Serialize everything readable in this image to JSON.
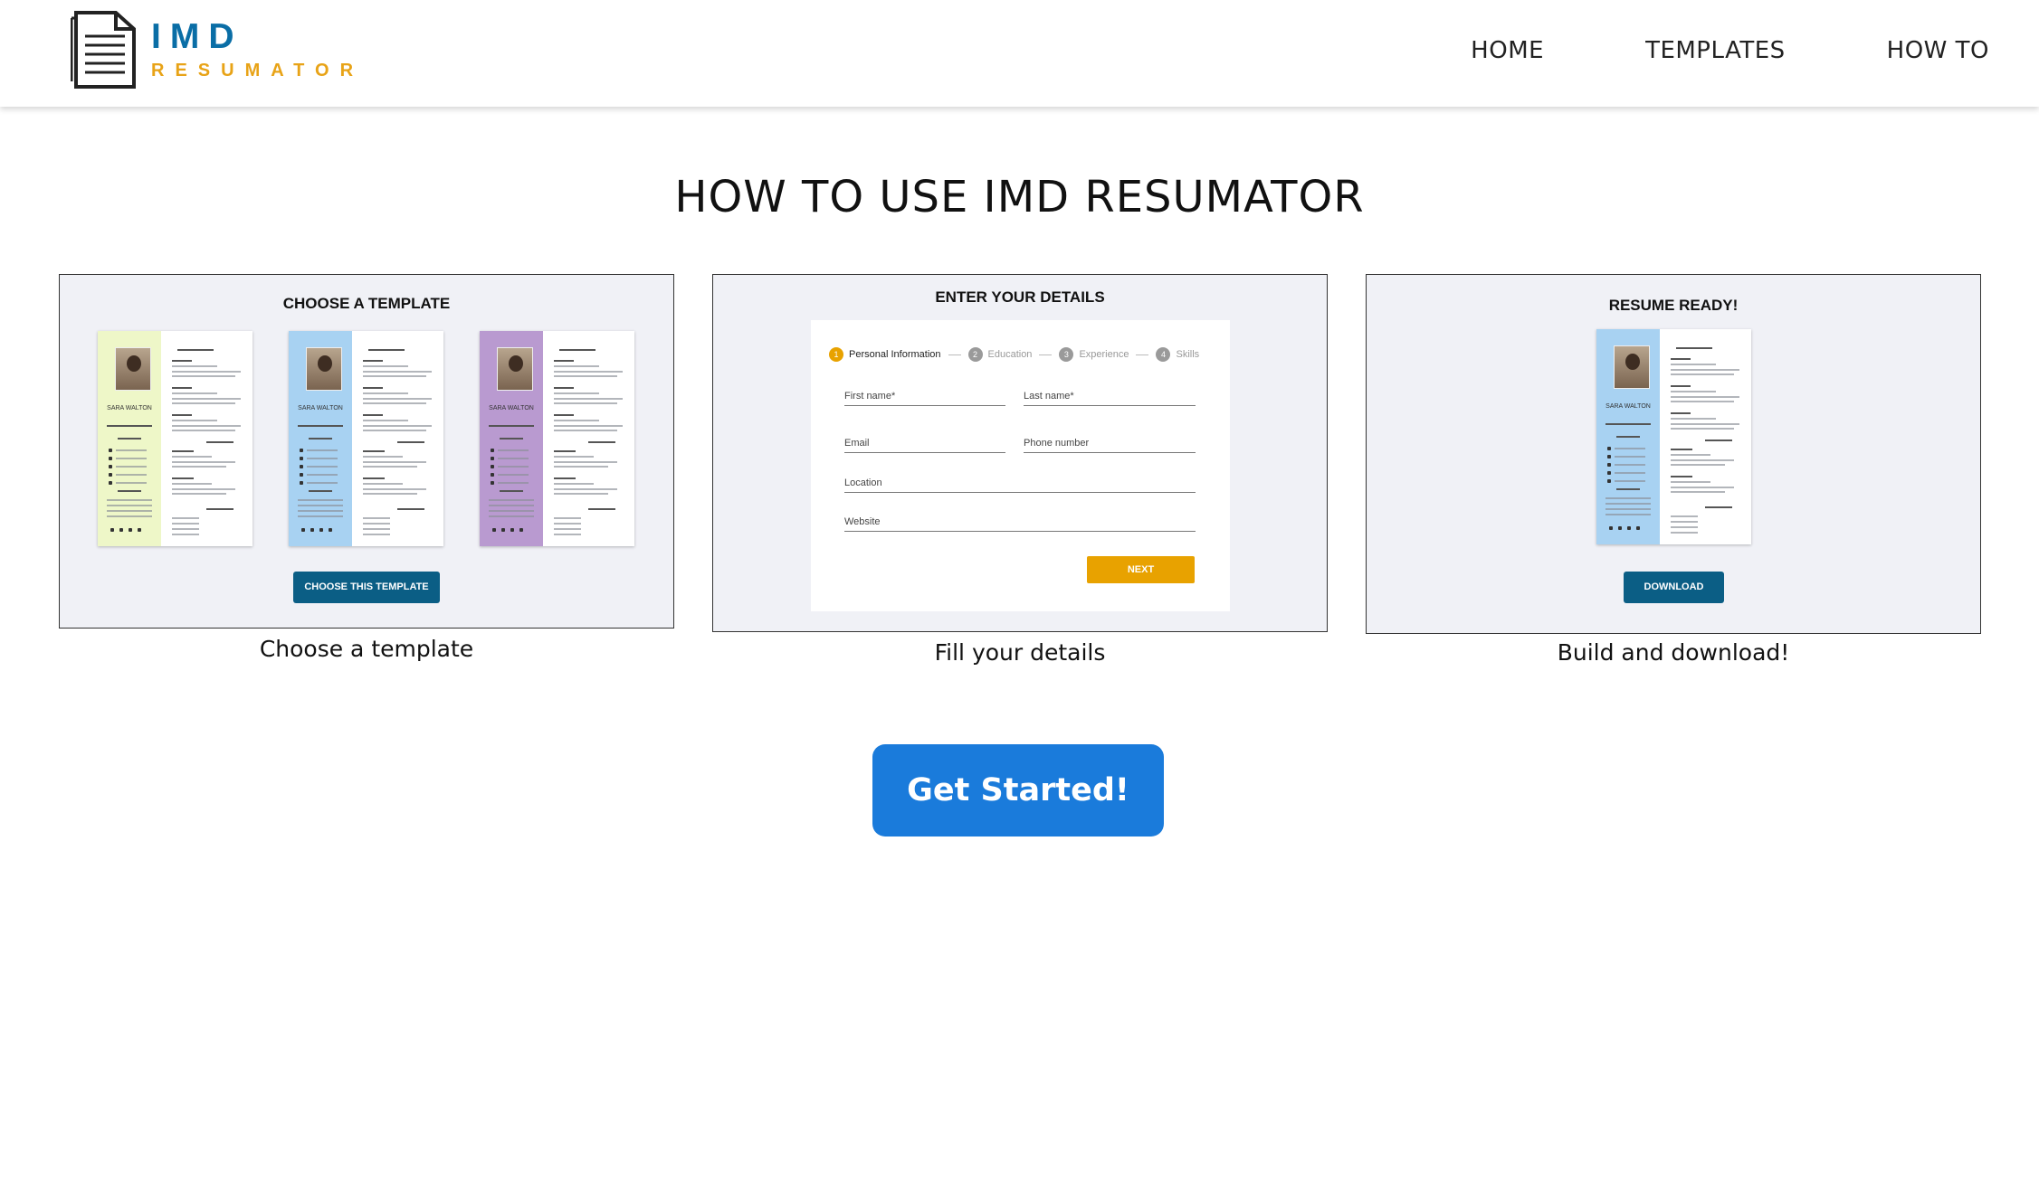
{
  "brand": {
    "line1": "IMD",
    "line2": "RESUMATOR",
    "primary": "#0a6ea6",
    "accent": "#e8a317"
  },
  "nav": {
    "home": "HOME",
    "templates": "TEMPLATES",
    "howto": "HOW TO"
  },
  "title": "HOW TO USE IMD RESUMATOR",
  "steps": [
    {
      "card_title": "CHOOSE A TEMPLATE",
      "caption": "Choose a template",
      "button": "CHOOSE THIS TEMPLATE",
      "resume_name": "SARA WALTON",
      "sidebar_colors": [
        "#eef7c8",
        "#a8d2f2",
        "#b99ad0"
      ]
    },
    {
      "card_title": "ENTER YOUR DETAILS",
      "caption": "Fill your details",
      "stepper": [
        {
          "num": "1",
          "label": "Personal Information"
        },
        {
          "num": "2",
          "label": "Education"
        },
        {
          "num": "3",
          "label": "Experience"
        },
        {
          "num": "4",
          "label": "Skills"
        }
      ],
      "fields": {
        "first": "First name*",
        "last": "Last name*",
        "email": "Email",
        "phone": "Phone number",
        "location": "Location",
        "website": "Website"
      },
      "next": "NEXT"
    },
    {
      "card_title": "RESUME READY!",
      "caption": "Build and download!",
      "button": "DOWNLOAD",
      "resume_name": "SARA WALTON",
      "sidebar_color": "#a8d2f2"
    }
  ],
  "cta": "Get Started!",
  "cta_color": "#1a7bdb"
}
